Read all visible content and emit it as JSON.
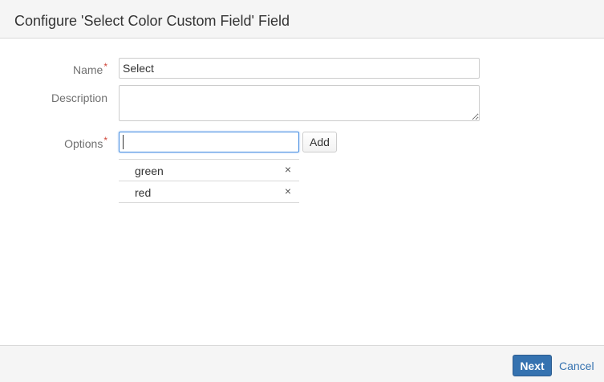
{
  "dialog": {
    "title": "Configure 'Select Color Custom Field' Field"
  },
  "form": {
    "name": {
      "label": "Name",
      "required_mark": "*",
      "value": "Select"
    },
    "description": {
      "label": "Description",
      "value": ""
    },
    "options": {
      "label": "Options",
      "required_mark": "*",
      "input_value": "",
      "add_label": "Add",
      "items": [
        {
          "label": "green",
          "remove_icon": "×"
        },
        {
          "label": "red",
          "remove_icon": "×"
        }
      ]
    }
  },
  "footer": {
    "next_label": "Next",
    "cancel_label": "Cancel"
  },
  "colors": {
    "accent": "#3572b0",
    "required": "#d04437",
    "header_bg": "#f5f5f5"
  }
}
